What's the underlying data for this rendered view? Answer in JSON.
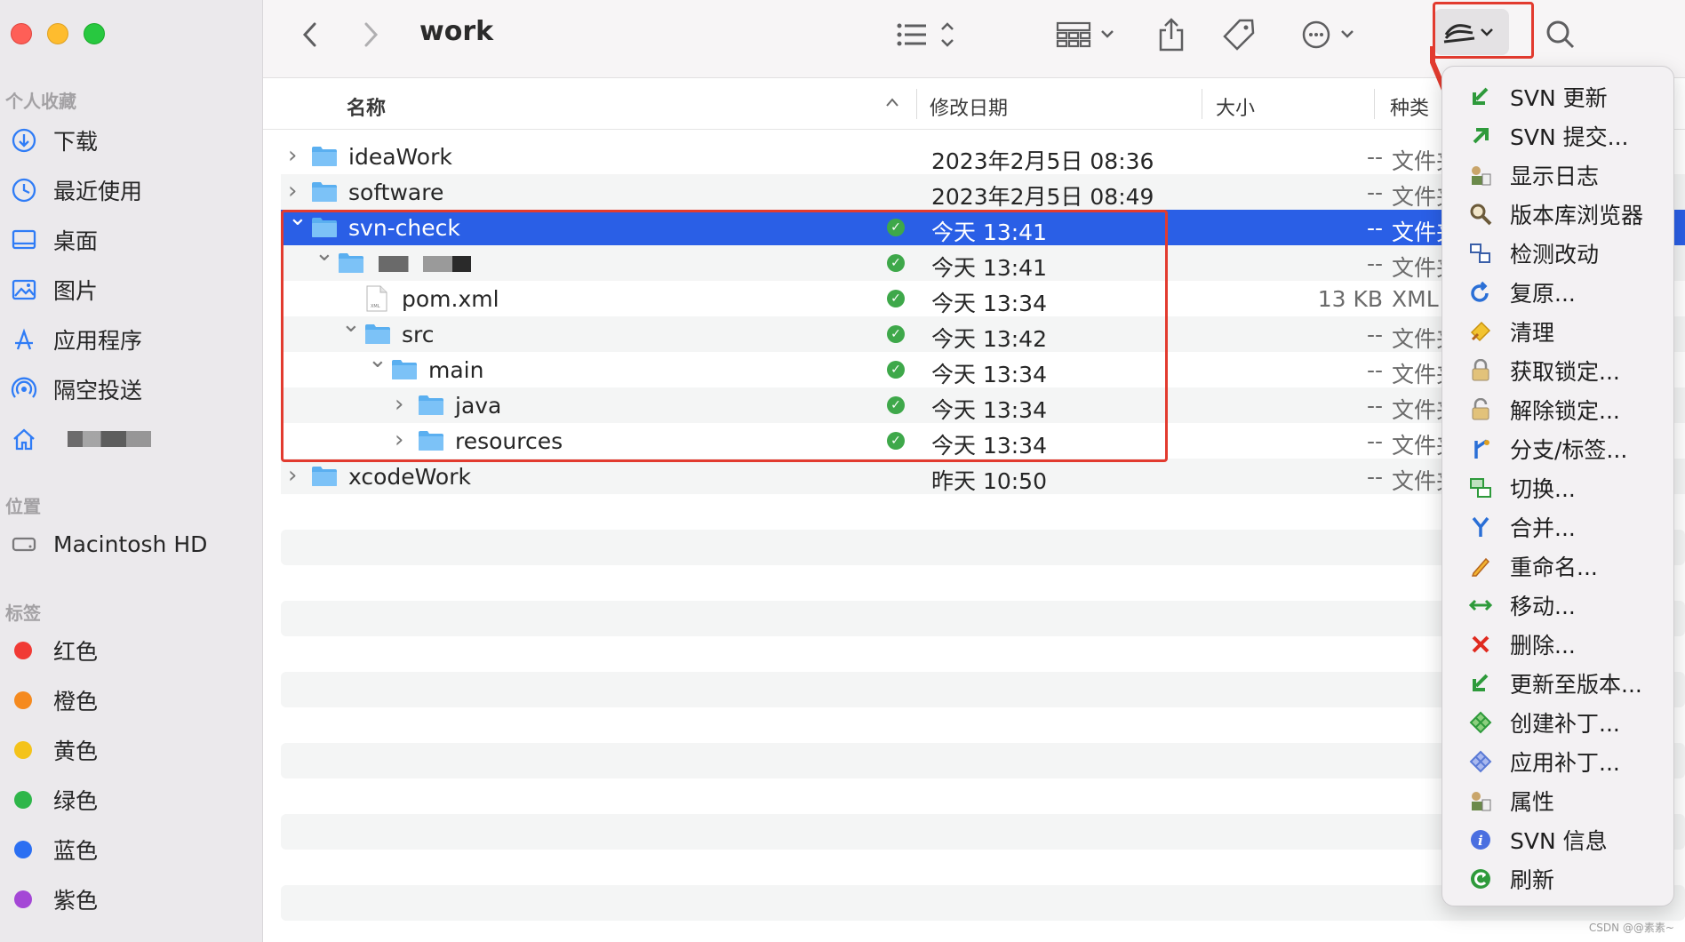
{
  "window": {
    "title": "work"
  },
  "sidebar": {
    "favorites_header": "个人收藏",
    "favorites": [
      {
        "label": "下载",
        "icon": "download-icon"
      },
      {
        "label": "最近使用",
        "icon": "clock-icon"
      },
      {
        "label": "桌面",
        "icon": "desktop-icon"
      },
      {
        "label": "图片",
        "icon": "photo-icon"
      },
      {
        "label": "应用程序",
        "icon": "apps-icon"
      },
      {
        "label": "隔空投送",
        "icon": "airdrop-icon"
      },
      {
        "label": "",
        "icon": "home-icon"
      }
    ],
    "locations_header": "位置",
    "locations": [
      {
        "label": "Macintosh HD",
        "icon": "disk-icon"
      }
    ],
    "tags_header": "标签",
    "tags": [
      {
        "label": "红色",
        "color": "#f13a35"
      },
      {
        "label": "橙色",
        "color": "#f58a1f"
      },
      {
        "label": "黄色",
        "color": "#f4c31a"
      },
      {
        "label": "绿色",
        "color": "#2fb64a"
      },
      {
        "label": "蓝色",
        "color": "#2b6ff2"
      },
      {
        "label": "紫色",
        "color": "#a447d6"
      }
    ]
  },
  "columns": {
    "name": "名称",
    "date": "修改日期",
    "size": "大小",
    "kind": "种类"
  },
  "files": [
    {
      "name": "ideaWork",
      "date": "2023年2月5日 08:36",
      "size": "--",
      "kind": "文件夹",
      "level": 0,
      "expanded": false,
      "type": "folder",
      "svn": false
    },
    {
      "name": "software",
      "date": "2023年2月5日 08:49",
      "size": "--",
      "kind": "文件夹",
      "level": 0,
      "expanded": false,
      "type": "folder",
      "svn": false
    },
    {
      "name": "svn-check",
      "date": "今天 13:41",
      "size": "--",
      "kind": "文件夹",
      "level": 0,
      "expanded": true,
      "type": "folder",
      "svn": true,
      "selected": true
    },
    {
      "name": "",
      "date": "今天 13:41",
      "size": "--",
      "kind": "文件夹",
      "level": 1,
      "expanded": true,
      "type": "folder",
      "svn": true,
      "redacted": true
    },
    {
      "name": "pom.xml",
      "date": "今天 13:34",
      "size": "13 KB",
      "kind": "XML",
      "level": 2,
      "type": "file",
      "svn": true
    },
    {
      "name": "src",
      "date": "今天 13:42",
      "size": "--",
      "kind": "文件夹",
      "level": 2,
      "expanded": true,
      "type": "folder",
      "svn": true
    },
    {
      "name": "main",
      "date": "今天 13:34",
      "size": "--",
      "kind": "文件夹",
      "level": 3,
      "expanded": true,
      "type": "folder",
      "svn": true
    },
    {
      "name": "java",
      "date": "今天 13:34",
      "size": "--",
      "kind": "文件夹",
      "level": 4,
      "expanded": false,
      "type": "folder",
      "svn": true
    },
    {
      "name": "resources",
      "date": "今天 13:34",
      "size": "--",
      "kind": "文件夹",
      "level": 4,
      "expanded": false,
      "type": "folder",
      "svn": true
    },
    {
      "name": "xcodeWork",
      "date": "昨天 10:50",
      "size": "--",
      "kind": "文件夹",
      "level": 0,
      "expanded": false,
      "type": "folder",
      "svn": false
    }
  ],
  "svn_menu": [
    {
      "label": "SVN 更新",
      "icon": "svn-update-icon",
      "color": "#2e9a3b"
    },
    {
      "label": "SVN 提交...",
      "icon": "svn-commit-icon",
      "color": "#2e9a3b"
    },
    {
      "label": "显示日志",
      "icon": "log-icon",
      "color": "#6b5a3a"
    },
    {
      "label": "版本库浏览器",
      "icon": "repo-browser-icon",
      "color": "#6b5a3a"
    },
    {
      "label": "检测改动",
      "icon": "check-modifications-icon",
      "color": "#3a5fa8"
    },
    {
      "label": "复原...",
      "icon": "revert-icon",
      "color": "#2a6fd6"
    },
    {
      "label": "清理",
      "icon": "cleanup-icon",
      "color": "#d9a21a"
    },
    {
      "label": "获取锁定...",
      "icon": "lock-icon",
      "color": "#9c8a6a"
    },
    {
      "label": "解除锁定...",
      "icon": "unlock-icon",
      "color": "#9c8a6a"
    },
    {
      "label": "分支/标签...",
      "icon": "branch-icon",
      "color": "#2a6fd6"
    },
    {
      "label": "切换...",
      "icon": "switch-icon",
      "color": "#2e9a3b"
    },
    {
      "label": "合并...",
      "icon": "merge-icon",
      "color": "#2a6fd6"
    },
    {
      "label": "重命名...",
      "icon": "rename-icon",
      "color": "#e0a020"
    },
    {
      "label": "移动...",
      "icon": "move-icon",
      "color": "#2e9a3b"
    },
    {
      "label": "删除...",
      "icon": "delete-icon",
      "color": "#e02a1f"
    },
    {
      "label": "更新至版本...",
      "icon": "update-to-revision-icon",
      "color": "#2e9a3b"
    },
    {
      "label": "创建补丁...",
      "icon": "create-patch-icon",
      "color": "#2e9a3b"
    },
    {
      "label": "应用补丁...",
      "icon": "apply-patch-icon",
      "color": "#5a7ad6"
    },
    {
      "label": "属性",
      "icon": "properties-icon",
      "color": "#6b5a3a"
    },
    {
      "label": "SVN 信息",
      "icon": "info-icon",
      "color": "#3a5fd6"
    },
    {
      "label": "刷新",
      "icon": "refresh-icon",
      "color": "#2e9a3b"
    }
  ],
  "watermark": "CSDN @@素素~"
}
